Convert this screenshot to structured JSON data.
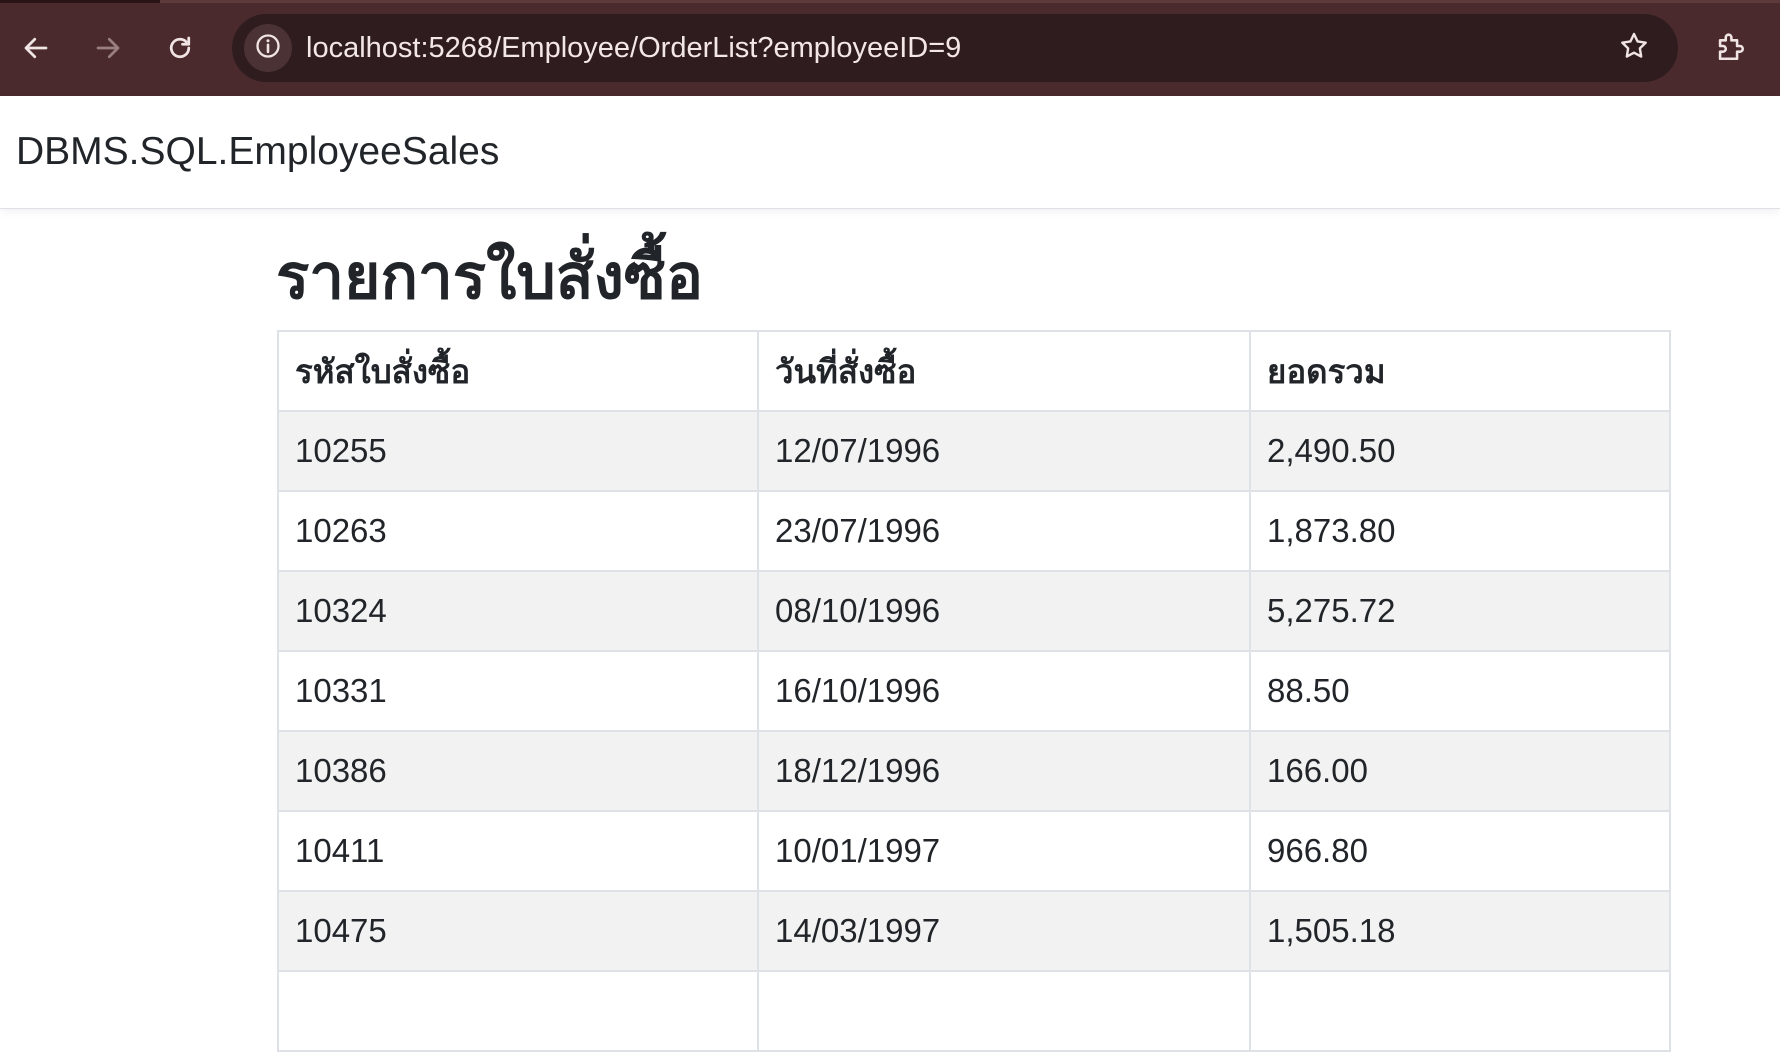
{
  "browser": {
    "url": "localhost:5268/Employee/OrderList?employeeID=9",
    "icons": {
      "back": "back-arrow-icon",
      "forward": "forward-arrow-icon",
      "reload": "reload-icon",
      "site_info": "info-icon",
      "bookmark": "star-icon",
      "extensions": "puzzle-icon"
    },
    "colors": {
      "toolbar": "#4a2a2c",
      "omnibox": "#2f1c1e"
    }
  },
  "navbar": {
    "brand": "DBMS.SQL.EmployeeSales"
  },
  "main": {
    "title": "รายการใบสั่งซื้อ",
    "table": {
      "headers": [
        "รหัสใบสั่งซื้อ",
        "วันที่สั่งซื้อ",
        "ยอดรวม"
      ],
      "rows": [
        [
          "10255",
          "12/07/1996",
          "2,490.50"
        ],
        [
          "10263",
          "23/07/1996",
          "1,873.80"
        ],
        [
          "10324",
          "08/10/1996",
          "5,275.72"
        ],
        [
          "10331",
          "16/10/1996",
          "88.50"
        ],
        [
          "10386",
          "18/12/1996",
          "166.00"
        ],
        [
          "10411",
          "10/01/1997",
          "966.80"
        ],
        [
          "10475",
          "14/03/1997",
          "1,505.18"
        ],
        [
          "",
          "",
          ""
        ]
      ]
    }
  }
}
